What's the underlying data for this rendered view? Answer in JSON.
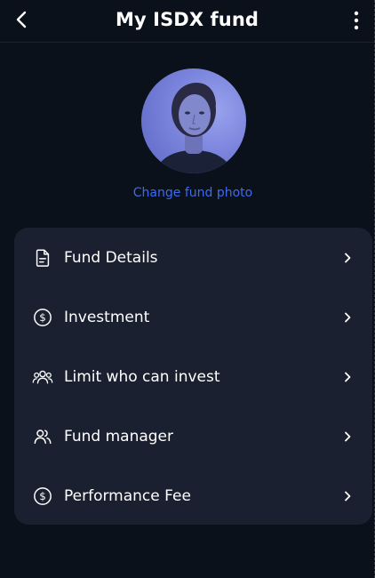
{
  "header": {
    "title": "My ISDX fund",
    "back_icon": "chevron-left-icon",
    "more_icon": "vertical-dots-icon"
  },
  "profile": {
    "change_photo_label": "Change fund photo"
  },
  "menu": {
    "items": [
      {
        "label": "Fund Details",
        "icon": "document-icon"
      },
      {
        "label": "Investment",
        "icon": "dollar-circle-icon"
      },
      {
        "label": "Limit who can invest",
        "icon": "group-icon"
      },
      {
        "label": "Fund manager",
        "icon": "people-icon"
      },
      {
        "label": "Performance Fee",
        "icon": "dollar-circle-icon"
      }
    ]
  },
  "colors": {
    "background": "#0b111a",
    "card": "#1b2030",
    "accent": "#3d6bf0",
    "text": "#ffffff"
  }
}
